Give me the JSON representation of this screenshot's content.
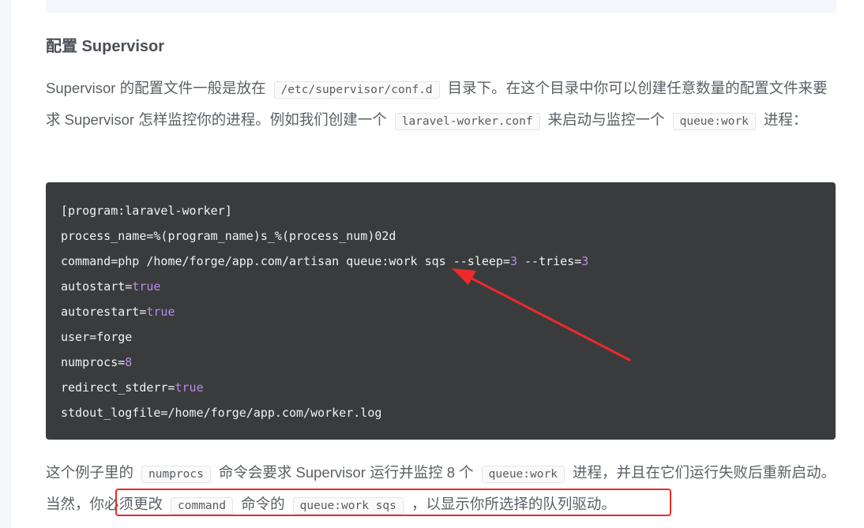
{
  "heading": "配置 Supervisor",
  "intro": {
    "t1": "Supervisor 的配置文件一般是放在",
    "c1": "/etc/supervisor/conf.d",
    "t2": "目录下。在这个目录中你可以创建任意数量的配置文件来要求 Supervisor 怎样监控你的进程。例如我们创建一个",
    "c2": "laravel-worker.conf",
    "t3": "来启动与监控一个",
    "c3": "queue:work",
    "t4": "进程："
  },
  "code": {
    "l1": "[program:laravel-worker]",
    "l2": "process_name=%(program_name)s_%(process_num)02d",
    "l3a": "command=php /home/forge/app.com/artisan queue:work sqs --sleep=",
    "l3b": "3",
    "l3c": " --tries=",
    "l3d": "3",
    "l4a": "autostart=",
    "l4b": "true",
    "l5a": "autorestart=",
    "l5b": "true",
    "l6": "user=forge",
    "l7a": "numprocs=",
    "l7b": "8",
    "l8a": "redirect_stderr=",
    "l8b": "true",
    "l9": "stdout_logfile=/home/forge/app.com/worker.log"
  },
  "outro": {
    "t1": "这个例子里的",
    "c1": "numprocs",
    "t2": "命令会要求 Supervisor 运行并监控 8 个",
    "c2": "queue:work",
    "t3": "进程，并且在它们运行失败后重新启动。当然，你必须更改",
    "c3": "command",
    "t4": "命令的",
    "c4": "queue:work sqs",
    "t5": "，以显示你所选择的队列驱动。"
  },
  "colors": {
    "annotation": "#ec2a2a",
    "code_bg": "#3a3b3d",
    "code_keyword": "#b68ce8"
  }
}
